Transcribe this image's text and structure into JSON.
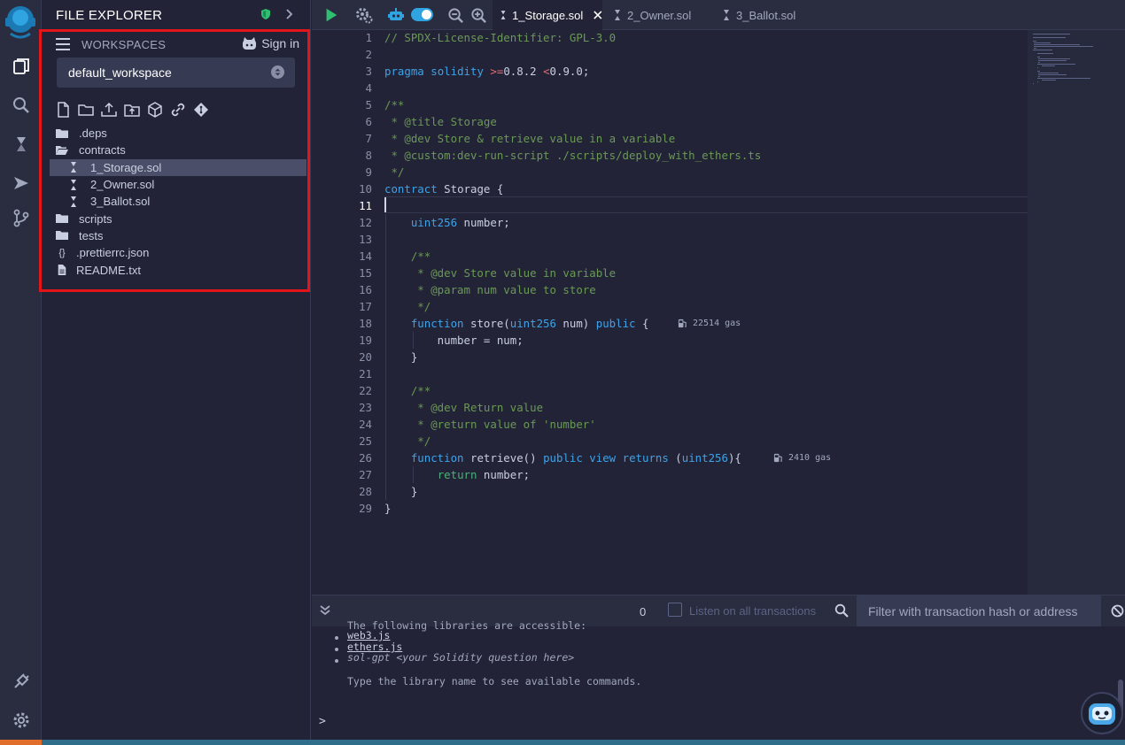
{
  "panel": {
    "title": "FILE EXPLORER",
    "workspaces_label": "WORKSPACES",
    "sign_in": "Sign in",
    "workspace": "default_workspace"
  },
  "tree": [
    {
      "label": ".deps",
      "kind": "folder",
      "level": 0
    },
    {
      "label": "contracts",
      "kind": "folder-open",
      "level": 0
    },
    {
      "label": "1_Storage.sol",
      "kind": "sol",
      "level": 1,
      "selected": true
    },
    {
      "label": "2_Owner.sol",
      "kind": "sol",
      "level": 1
    },
    {
      "label": "3_Ballot.sol",
      "kind": "sol",
      "level": 1
    },
    {
      "label": "scripts",
      "kind": "folder",
      "level": 0
    },
    {
      "label": "tests",
      "kind": "folder",
      "level": 0
    },
    {
      "label": ".prettierrc.json",
      "kind": "json",
      "level": 0
    },
    {
      "label": "README.txt",
      "kind": "file",
      "level": 0
    }
  ],
  "tabs": [
    {
      "label": "1_Storage.sol",
      "active": true
    },
    {
      "label": "2_Owner.sol",
      "active": false
    },
    {
      "label": "3_Ballot.sol",
      "active": false
    }
  ],
  "editor": {
    "current_line": 11,
    "lines": [
      "// SPDX-License-Identifier: GPL-3.0",
      "",
      "pragma solidity >=0.8.2 <0.9.0;",
      "",
      "/**",
      " * @title Storage",
      " * @dev Store & retrieve value in a variable",
      " * @custom:dev-run-script ./scripts/deploy_with_ethers.ts",
      " */",
      "contract Storage {",
      "",
      "    uint256 number;",
      "",
      "    /**",
      "     * @dev Store value in variable",
      "     * @param num value to store",
      "     */",
      "    function store(uint256 num) public {",
      "        number = num;",
      "    }",
      "",
      "    /**",
      "     * @dev Return value",
      "     * @return value of 'number'",
      "     */",
      "    function retrieve() public view returns (uint256){",
      "        return number;",
      "    }",
      "}"
    ],
    "gas_store": "22514 gas",
    "gas_retrieve": "2410 gas"
  },
  "terminal": {
    "tx_count": "0",
    "listen_label": "Listen on all transactions",
    "filter_placeholder": "Filter with transaction hash or address",
    "lines": [
      "The following libraries are accessible:",
      "web3.js",
      "ethers.js",
      "sol-gpt <your Solidity question here>",
      "Type the library name to see available commands."
    ],
    "prompt": ">"
  }
}
